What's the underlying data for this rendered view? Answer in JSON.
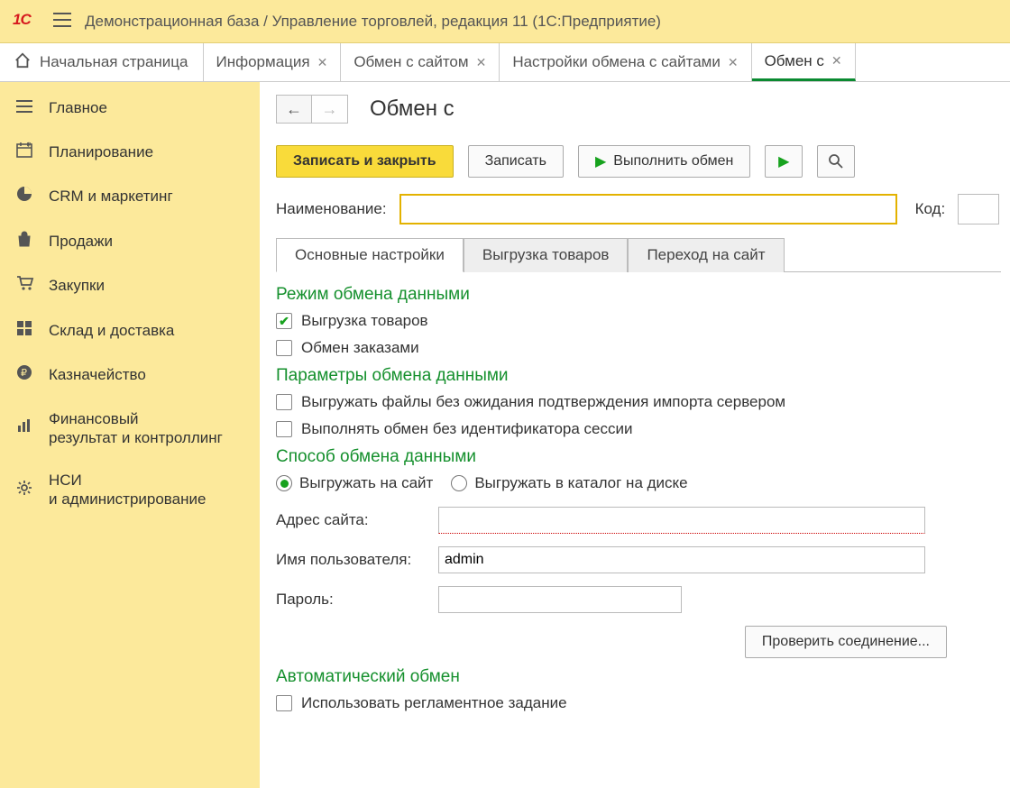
{
  "title": "Демонстрационная база / Управление торговлей, редакция 11  (1С:Предприятие)",
  "logo": "1C",
  "hometab": "Начальная страница",
  "tabs": [
    {
      "label": "Информация",
      "closable": true,
      "active": false
    },
    {
      "label": "Обмен с сайтом",
      "closable": true,
      "active": false
    },
    {
      "label": "Настройки обмена с сайтами",
      "closable": true,
      "active": false
    },
    {
      "label": "Обмен с",
      "closable": true,
      "active": true
    }
  ],
  "sidebar": [
    {
      "icon": "≡",
      "label": "Главное"
    },
    {
      "icon": "calendar",
      "label": "Планирование"
    },
    {
      "icon": "pie",
      "label": "CRM и маркетинг"
    },
    {
      "icon": "bag",
      "label": "Продажи"
    },
    {
      "icon": "cart",
      "label": "Закупки"
    },
    {
      "icon": "grid",
      "label": "Склад и доставка"
    },
    {
      "icon": "ruble",
      "label": "Казначейство"
    },
    {
      "icon": "bars",
      "label": "Финансовый\nрезультат и контроллинг"
    },
    {
      "icon": "gear",
      "label": "НСИ\nи администрирование"
    }
  ],
  "form": {
    "title": "Обмен с",
    "toolbar": {
      "save_close": "Записать и закрыть",
      "save": "Записать",
      "exchange": "Выполнить обмен"
    },
    "name_label": "Наименование:",
    "name_value": "",
    "code_label": "Код:",
    "code_value": "",
    "inner_tabs": [
      "Основные настройки",
      "Выгрузка товаров",
      "Переход на сайт"
    ],
    "sec_mode": "Режим обмена данными",
    "cb_export_goods": "Выгрузка товаров",
    "cb_export_goods_checked": true,
    "cb_exchange_orders": "Обмен заказами",
    "cb_exchange_orders_checked": false,
    "sec_params": "Параметры обмена данными",
    "cb_nowait": "Выгружать файлы без ожидания подтверждения импорта сервером",
    "cb_nowait_checked": false,
    "cb_nosession": "Выполнять обмен без идентификатора сессии",
    "cb_nosession_checked": false,
    "sec_method": "Способ обмена данными",
    "rb_site": "Выгружать на сайт",
    "rb_disk": "Выгружать в каталог на диске",
    "rb_selected": "site",
    "addr_label": "Адрес сайта:",
    "addr_value": "",
    "user_label": "Имя пользователя:",
    "user_value": "admin",
    "pass_label": "Пароль:",
    "pass_value": "",
    "check_label": "Проверить соединение...",
    "sec_auto": "Автоматический обмен",
    "cb_sched": "Использовать регламентное задание",
    "cb_sched_checked": false
  }
}
